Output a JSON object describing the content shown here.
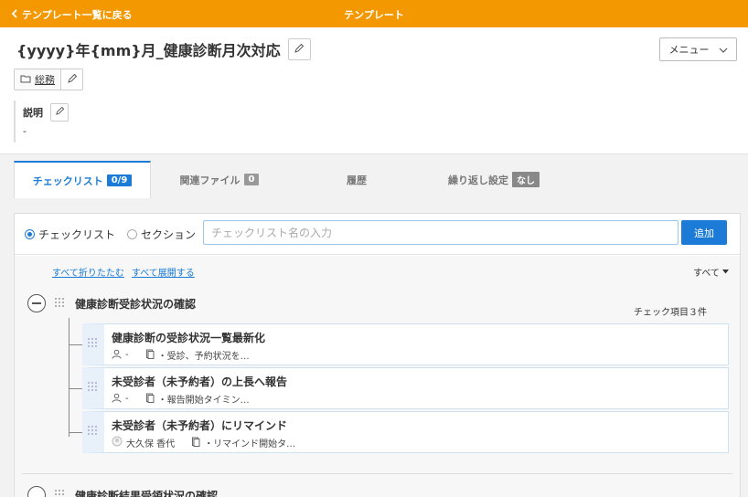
{
  "topbar": {
    "back_label": "テンプレート一覧に戻る",
    "title": "テンプレート"
  },
  "template": {
    "title": "{yyyy}年{mm}月_健康診断月次対応",
    "category": "総務",
    "description_label": "説明",
    "description_value": "-"
  },
  "menu": {
    "label": "メニュー"
  },
  "tabs": [
    {
      "label": "チェックリスト",
      "badge": "0/9"
    },
    {
      "label": "関連ファイル",
      "badge": "0"
    },
    {
      "label": "履歴",
      "badge": ""
    },
    {
      "label": "繰り返し設定",
      "badge": "なし"
    }
  ],
  "add_form": {
    "radio_checklist": "チェックリスト",
    "radio_section": "セクション",
    "placeholder": "チェックリスト名の入力",
    "add_button": "追加"
  },
  "list": {
    "collapse_all": "すべて折りたたむ",
    "expand_all": "すべて展開する",
    "filter": "すべて",
    "sections": [
      {
        "title": "健康診断受診状況の確認",
        "count": "チェック項目３件",
        "items": [
          {
            "title": "健康診断の受診状況一覧最新化",
            "assignee": "-",
            "note": "・受診、予約状況を…"
          },
          {
            "title": "未受診者（未予約者）の上長へ報告",
            "assignee": "-",
            "note": "・報告開始タイミン…"
          },
          {
            "title": "未受診者（未予約者）にリマインド",
            "assignee": "大久保 香代",
            "note": "・リマインド開始タ…"
          }
        ]
      },
      {
        "title": "健康診断結果受領状況の確認"
      }
    ]
  }
}
